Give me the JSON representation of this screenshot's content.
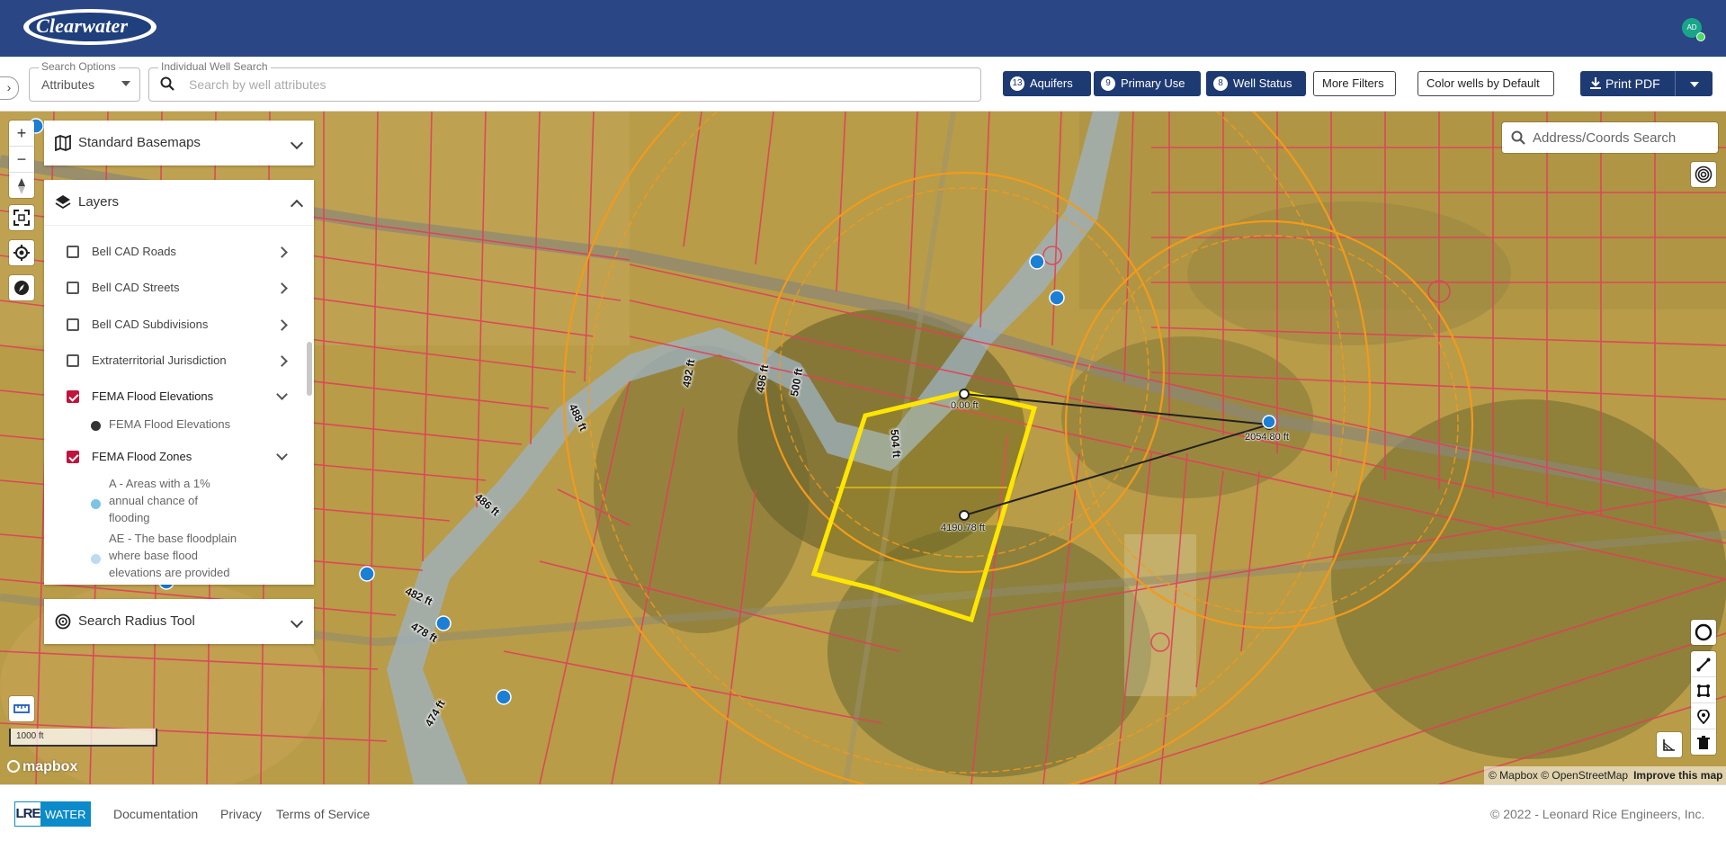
{
  "header": {
    "app_name": "Clearwater",
    "avatar_initials": "AD"
  },
  "search": {
    "options_legend": "Search Options",
    "options_value": "Attributes",
    "well_legend": "Individual Well Search",
    "well_placeholder": "Search by well attributes"
  },
  "filters": [
    {
      "count": "13",
      "label": "Aquifers"
    },
    {
      "count": "9",
      "label": "Primary Use"
    },
    {
      "count": "8",
      "label": "Well Status"
    }
  ],
  "toolbar": {
    "more_filters": "More Filters",
    "color_wells": "Color wells by Default",
    "print_pdf": "Print PDF"
  },
  "panels": {
    "basemaps": "Standard Basemaps",
    "layers": "Layers",
    "search_radius": "Search Radius Tool"
  },
  "layers": [
    {
      "label": "Bell CAD Roads",
      "checked": false
    },
    {
      "label": "Bell CAD Streets",
      "checked": false
    },
    {
      "label": "Bell CAD Subdivisions",
      "checked": false
    },
    {
      "label": "Extraterritorial Jurisdiction",
      "checked": false
    },
    {
      "label": "FEMA Flood Elevations",
      "checked": true
    },
    {
      "label": "FEMA Flood Zones",
      "checked": true
    }
  ],
  "legend": {
    "flood_elev": "FEMA Flood Elevations",
    "zone_a": [
      "A - Areas with a 1%",
      "annual chance of",
      "flooding"
    ],
    "zone_ae": [
      "AE - The base floodplain",
      "where base flood",
      "elevations are provided"
    ]
  },
  "map": {
    "address_placeholder": "Address/Coords Search",
    "scale_label": "1000 ft",
    "mapbox_wordmark": "mapbox",
    "attribution": "© Mapbox © OpenStreetMap",
    "improve": "Improve this map",
    "measure_labels": [
      "0.00 ft",
      "2054.80 ft",
      "4190.78 ft"
    ],
    "elevation_labels": [
      "492 ft",
      "488 ft",
      "486 ft",
      "482 ft",
      "478 ft",
      "474 ft",
      "496 ft",
      "500 ft",
      "504 ft"
    ]
  },
  "footer": {
    "brand_lre": "LRE",
    "brand_water": "WATER",
    "links": [
      "Documentation",
      "Privacy",
      "Terms of Service"
    ],
    "copyright": "© 2022 - Leonard Rice Engineers, Inc."
  },
  "colors": {
    "header": "#2a4684",
    "button_dark": "#1e3a72",
    "parcel_line": "#e0405a",
    "radius_ring": "#f39a1b",
    "parcel_highlight": "#ffe600",
    "flood_zone": "#9eb3c4",
    "well_point": "#1c7fd6"
  }
}
